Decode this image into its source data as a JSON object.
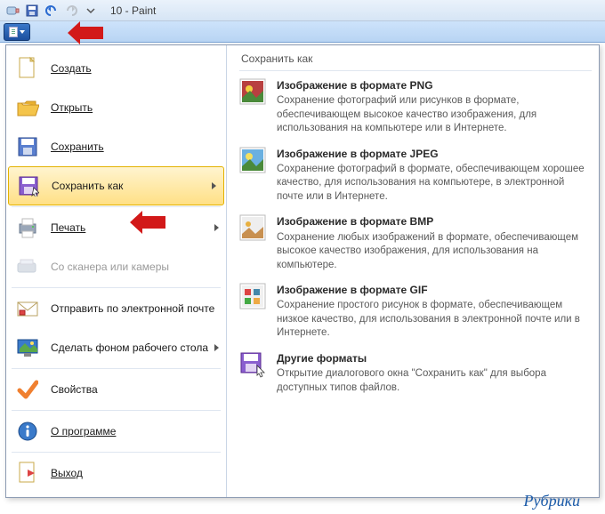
{
  "title": "10 - Paint",
  "menu": {
    "create": "Создать",
    "open": "Открыть",
    "save": "Сохранить",
    "saveas": "Сохранить как",
    "print": "Печать",
    "scanner": "Со сканера или камеры",
    "email": "Отправить по электронной почте",
    "wallpaper": "Сделать фоном рабочего стола",
    "properties": "Свойства",
    "about": "О программе",
    "exit": "Выход"
  },
  "panel": {
    "title": "Сохранить как",
    "png_h": "Изображение в формате PNG",
    "png_d": "Сохранение фотографий или рисунков в формате, обеспечивающем высокое качество изображения, для использования на компьютере или в Интернете.",
    "jpeg_h": "Изображение в формате JPEG",
    "jpeg_d": "Сохранение фотографий в формате, обеспечивающем хорошее качество, для использования на компьютере, в электронной почте или в Интернете.",
    "bmp_h": "Изображение в формате BMP",
    "bmp_d": "Сохранение любых изображений в формате, обеспечивающем высокое качество изображения, для использования на компьютере.",
    "gif_h": "Изображение в формате GIF",
    "gif_d": "Сохранение простого рисунок в формате, обеспечивающем низкое качество, для использования в электронной почте или в Интернете.",
    "other_h": "Другие форматы",
    "other_d": "Открытие диалогового окна \"Сохранить как\" для выбора доступных типов файлов."
  },
  "footer": "Рубрики"
}
